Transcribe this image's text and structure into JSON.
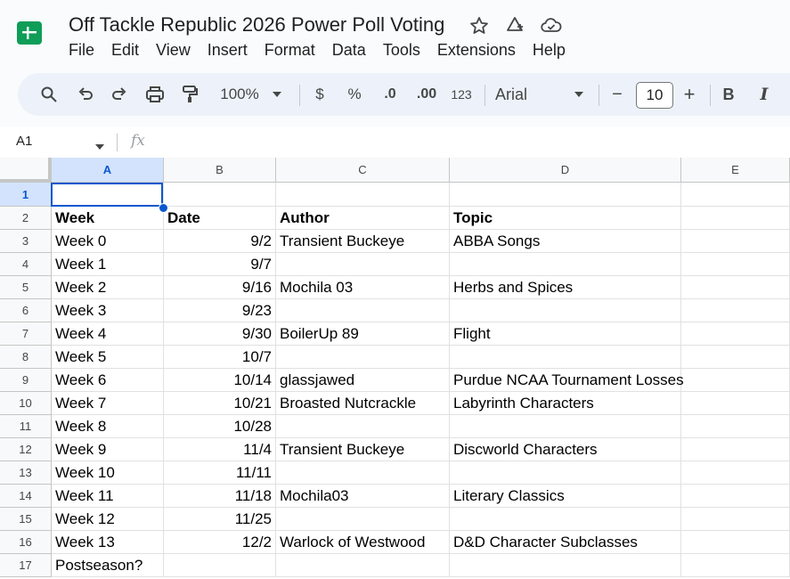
{
  "app": {
    "title": "Off Tackle Republic 2026 Power Poll Voting",
    "menu": [
      "File",
      "Edit",
      "View",
      "Insert",
      "Format",
      "Data",
      "Tools",
      "Extensions",
      "Help"
    ]
  },
  "toolbar": {
    "zoom": "100%",
    "currency": "$",
    "percent": "%",
    "decrease_decimal": ".0",
    "increase_decimal": ".00",
    "number_format": "123",
    "font": "Arial",
    "font_size": "10",
    "minus": "−",
    "plus": "+",
    "bold": "B",
    "italic": "I"
  },
  "formula_bar": {
    "name_box": "A1",
    "fx": "fx"
  },
  "sheet": {
    "columns": [
      "A",
      "B",
      "C",
      "D",
      "E"
    ],
    "rows": [
      [
        "",
        "",
        "",
        ""
      ],
      [
        "Week",
        "Date",
        "Author",
        "Topic"
      ],
      [
        "Week 0",
        "9/2",
        "Transient Buckeye",
        "ABBA Songs"
      ],
      [
        "Week 1",
        "9/7",
        "",
        ""
      ],
      [
        "Week 2",
        "9/16",
        "Mochila 03",
        "Herbs and Spices"
      ],
      [
        "Week 3",
        "9/23",
        "",
        ""
      ],
      [
        "Week 4",
        "9/30",
        "BoilerUp 89",
        "Flight"
      ],
      [
        "Week 5",
        "10/7",
        "",
        ""
      ],
      [
        "Week 6",
        "10/14",
        "glassjawed",
        "Purdue NCAA Tournament Losses"
      ],
      [
        "Week 7",
        "10/21",
        "Broasted Nutcrackle",
        "Labyrinth Characters"
      ],
      [
        "Week 8",
        "10/28",
        "",
        ""
      ],
      [
        "Week 9",
        "11/4",
        "Transient Buckeye",
        "Discworld Characters"
      ],
      [
        "Week 10",
        "11/11",
        "",
        ""
      ],
      [
        "Week 11",
        "11/18",
        "Mochila03",
        "Literary Classics"
      ],
      [
        "Week 12",
        "11/25",
        "",
        ""
      ],
      [
        "Week 13",
        "12/2",
        "Warlock of Westwood",
        "D&D Character Subclasses"
      ],
      [
        "Postseason?",
        "",
        "",
        ""
      ]
    ]
  },
  "colors": {
    "accent": "#0b57d0",
    "logo_green": "#0f9d58"
  }
}
